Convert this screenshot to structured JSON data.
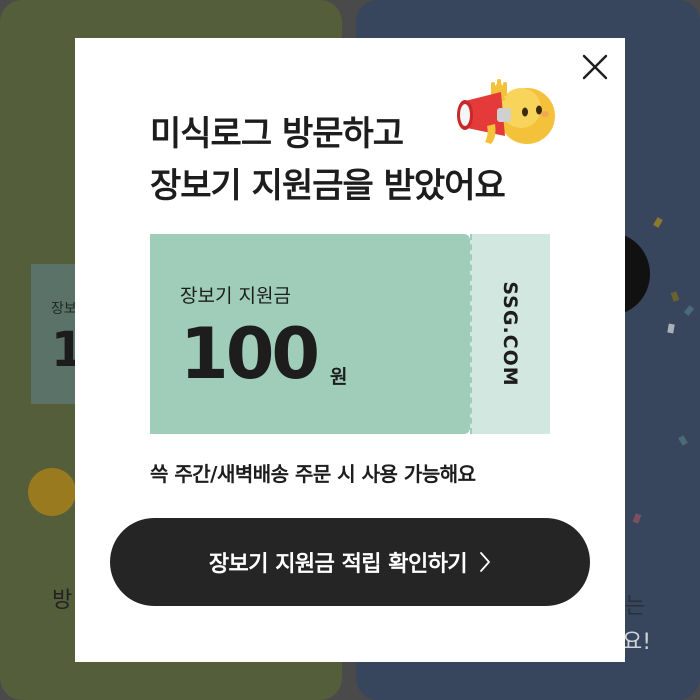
{
  "background": {
    "left_card": {
      "coupon_label": "장보",
      "coupon_amount": "1",
      "text": "방"
    },
    "right_card": {
      "text_line1": "는",
      "text_line2": "요!"
    }
  },
  "modal": {
    "close_icon": "close-icon",
    "title_line1": "미식로그 방문하고",
    "title_line2": "장보기 지원금을 받았어요",
    "emoji": "megaphone-emoji-icon",
    "coupon": {
      "label": "장보기 지원금",
      "amount": "100",
      "unit": "원",
      "brand": "SSG.COM",
      "color_main": "#9fcdb9",
      "color_stub": "#d2e7e0"
    },
    "notice": "쓱 주간/새벽배송 주문 시 사용 가능해요",
    "confirm_button": {
      "label": "장보기 지원금 적립 확인하기",
      "icon": "chevron-right-icon"
    }
  }
}
